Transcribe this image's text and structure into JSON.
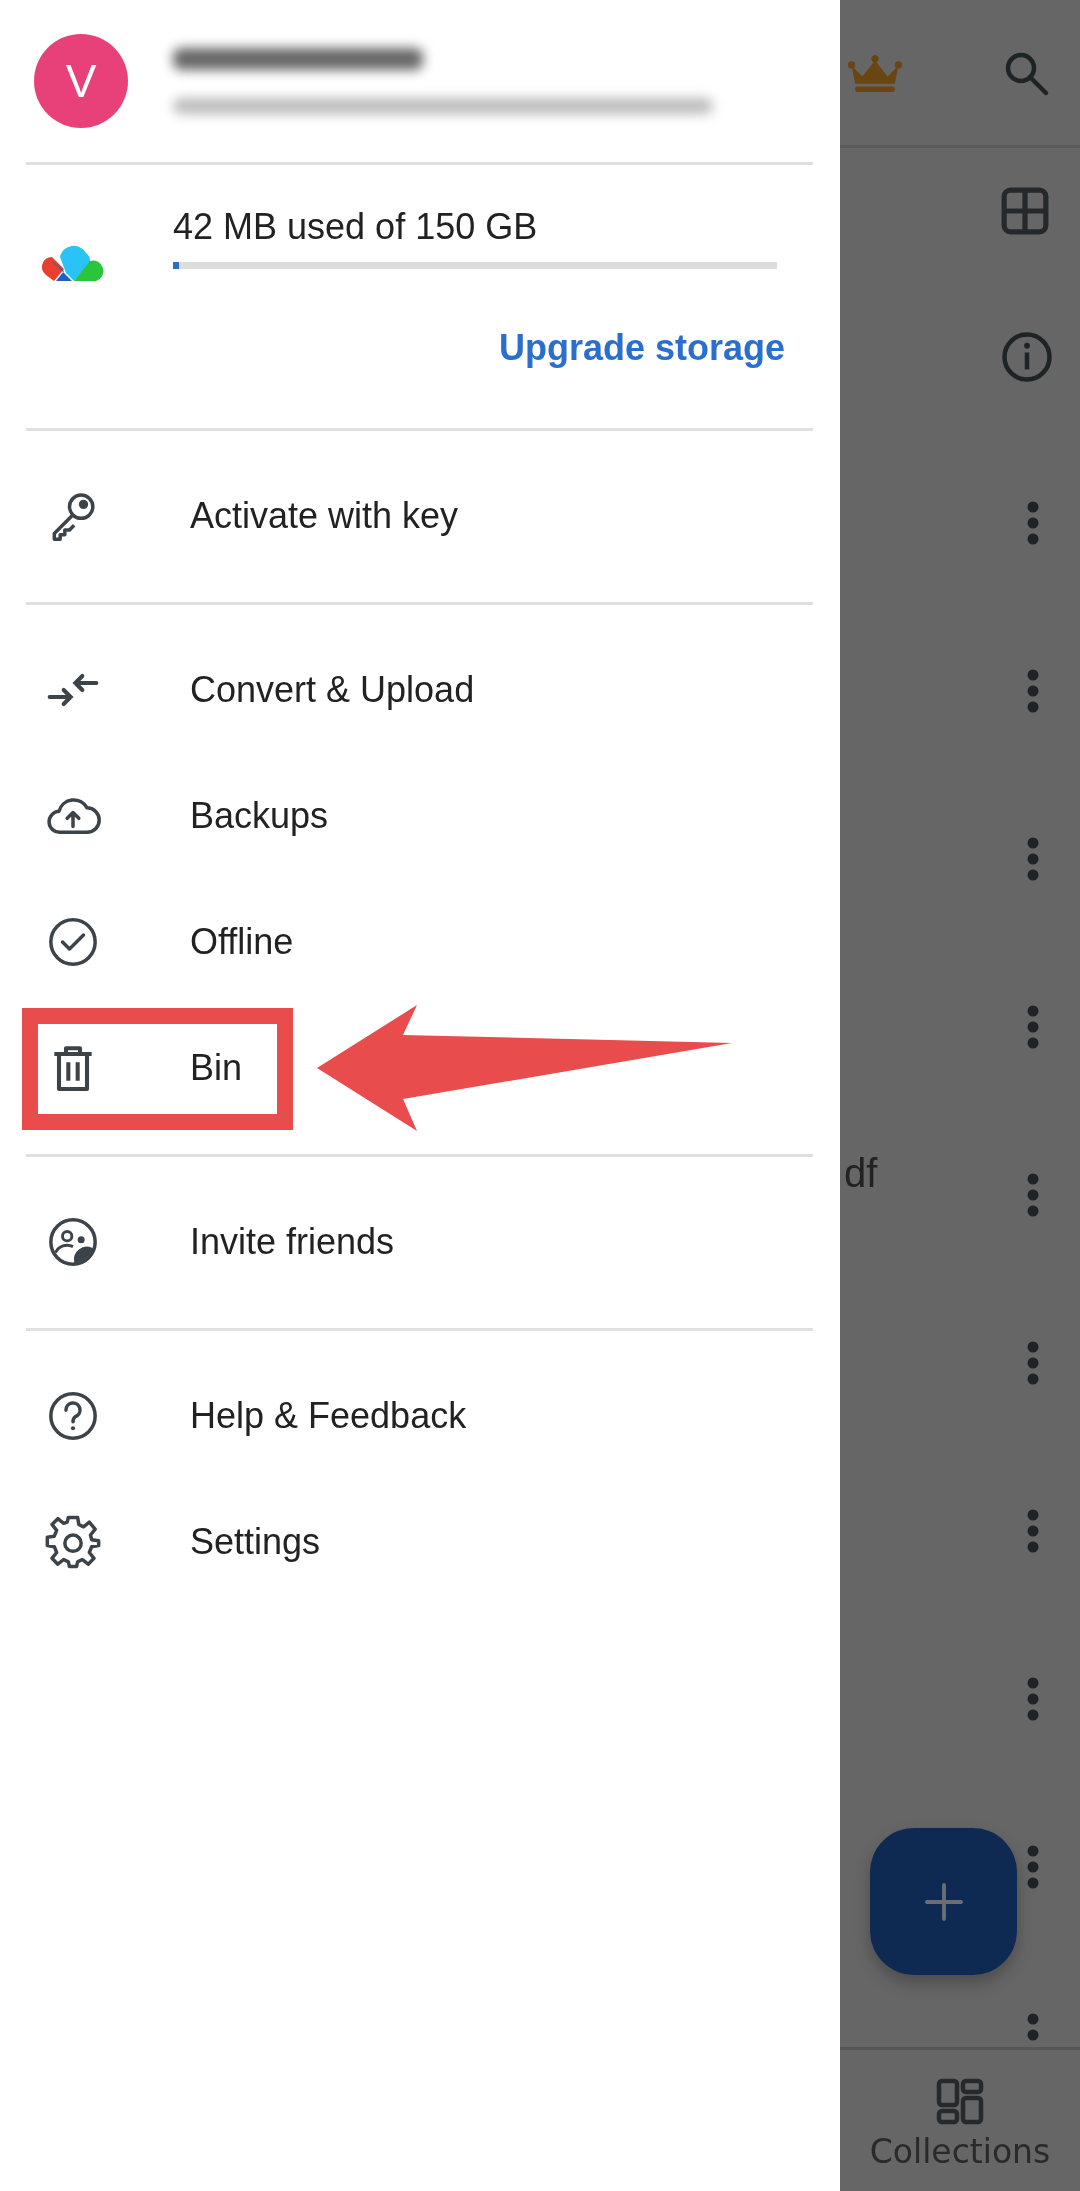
{
  "drawer": {
    "account": {
      "avatar_letter": "V"
    },
    "storage": {
      "text": "42 MB used of 150 GB",
      "level": 0.01,
      "action": "Upgrade storage"
    },
    "sections": [
      [
        {
          "kind": "key",
          "label": "Activate with key",
          "highlighted": false
        }
      ],
      [
        {
          "kind": "convert",
          "label": "Convert & Upload",
          "highlighted": false
        },
        {
          "kind": "backup",
          "label": "Backups",
          "highlighted": false
        },
        {
          "kind": "offline",
          "label": "Offline",
          "highlighted": false
        },
        {
          "kind": "bin",
          "label": "Bin",
          "highlighted": true
        }
      ],
      [
        {
          "kind": "invite",
          "label": "Invite friends",
          "highlighted": false
        }
      ],
      [
        {
          "kind": "help",
          "label": "Help & Feedback",
          "highlighted": false
        },
        {
          "kind": "settings",
          "label": "Settings",
          "highlighted": false
        }
      ]
    ]
  },
  "background": {
    "file_rows": [
      {
        "kind": "file"
      },
      {
        "kind": "file"
      },
      {
        "kind": "file"
      },
      {
        "kind": "file"
      },
      {
        "kind": "file",
        "name": "df"
      },
      {
        "kind": "file"
      },
      {
        "kind": "file"
      },
      {
        "kind": "file"
      },
      {
        "kind": "file"
      },
      {
        "kind": "file"
      }
    ],
    "bottom_nav": {
      "label": "Collections"
    }
  }
}
